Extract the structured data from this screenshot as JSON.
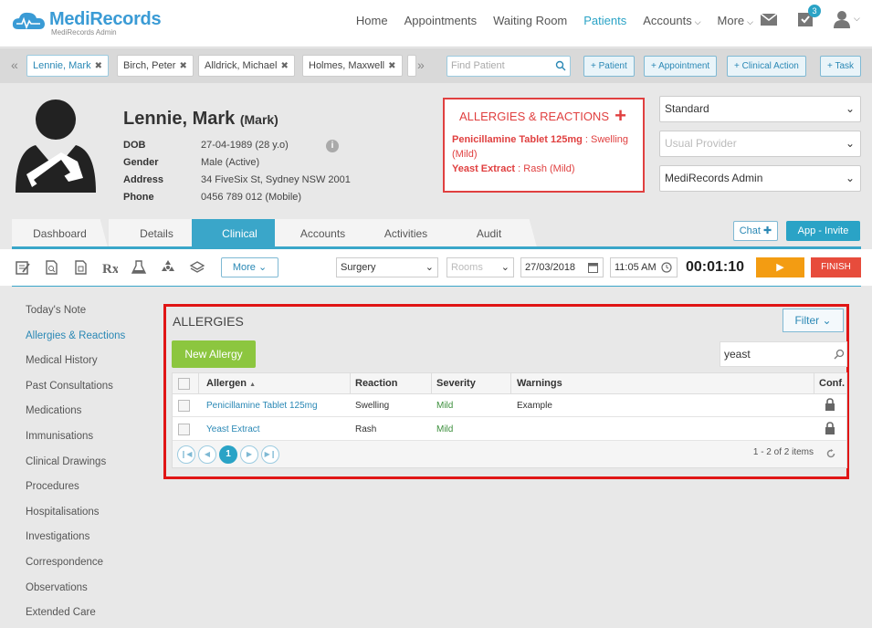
{
  "app": {
    "logo_name": "MediRecords",
    "logo_sub": "MediRecords Admin"
  },
  "nav": {
    "items": [
      {
        "label": "Home"
      },
      {
        "label": "Appointments"
      },
      {
        "label": "Waiting Room"
      },
      {
        "label": "Patients",
        "active": true
      },
      {
        "label": "Accounts",
        "caret": true
      },
      {
        "label": "More",
        "caret": true
      }
    ],
    "tasks_badge": "3"
  },
  "patient_tabs": {
    "tabs": [
      "Lennie, Mark",
      "Birch, Peter",
      "Alldrick, Michael",
      "Holmes, Maxwell"
    ],
    "find_placeholder": "Find Patient",
    "buttons": [
      "+ Patient",
      "+ Appointment",
      "+ Clinical Action",
      "+ Task"
    ]
  },
  "patient": {
    "name": "Lennie, Mark",
    "nickname": "(Mark)",
    "fields": [
      {
        "label": "DOB",
        "value": "27-04-1989 (28 y.o)"
      },
      {
        "label": "Gender",
        "value": "Male (Active)"
      },
      {
        "label": "Address",
        "value": "34 FiveSix St, Sydney NSW 2001"
      },
      {
        "label": "Phone",
        "value": "0456 789 012 (Mobile)"
      }
    ]
  },
  "allergy_summary": {
    "title": "ALLERGIES & REACTIONS",
    "items": [
      {
        "name": "Penicillamine Tablet 125mg",
        "reaction": "Swelling (Mild)"
      },
      {
        "name": "Yeast Extract",
        "reaction": "Rash (Mild)"
      }
    ]
  },
  "selectors": {
    "plan": "Standard",
    "provider_placeholder": "Usual Provider",
    "practice": "MediRecords Admin"
  },
  "section_tabs": [
    "Dashboard",
    "Details",
    "Clinical",
    "Accounts",
    "Activities",
    "Audit"
  ],
  "active_section": "Clinical",
  "header_buttons": {
    "chat": "Chat",
    "invite": "App - Invite"
  },
  "toolbar": {
    "more": "More",
    "location": "Surgery",
    "rooms_placeholder": "Rooms",
    "date": "27/03/2018",
    "time": "11:05 AM",
    "timer": "00:01:10",
    "finish": "FINISH"
  },
  "side_menu": [
    {
      "label": "Today's Note"
    },
    {
      "label": "Allergies & Reactions",
      "active": true
    },
    {
      "label": "Medical History"
    },
    {
      "label": "Past Consultations"
    },
    {
      "label": "Medications"
    },
    {
      "label": "Immunisations"
    },
    {
      "label": "Clinical Drawings"
    },
    {
      "label": "Procedures"
    },
    {
      "label": "Hospitalisations"
    },
    {
      "label": "Investigations"
    },
    {
      "label": "Correspondence"
    },
    {
      "label": "Observations"
    },
    {
      "label": "Extended Care"
    }
  ],
  "allergies_panel": {
    "title": "ALLERGIES",
    "filter": "Filter",
    "new_button": "New Allergy",
    "search_value": "yeast",
    "columns": {
      "allergen": "Allergen",
      "reaction": "Reaction",
      "severity": "Severity",
      "warnings": "Warnings",
      "conf": "Conf."
    },
    "rows": [
      {
        "allergen": "Penicillamine Tablet 125mg",
        "reaction": "Swelling",
        "severity": "Mild",
        "warnings": "Example"
      },
      {
        "allergen": "Yeast Extract",
        "reaction": "Rash",
        "severity": "Mild",
        "warnings": ""
      }
    ],
    "page": "1",
    "items_info": "1 - 2 of 2 items"
  },
  "colors": {
    "accent": "#2aa3c6",
    "allergy_red": "#e04040",
    "new_green": "#8cc63f",
    "play_orange": "#f39c12",
    "finish_red": "#e74c3c"
  }
}
